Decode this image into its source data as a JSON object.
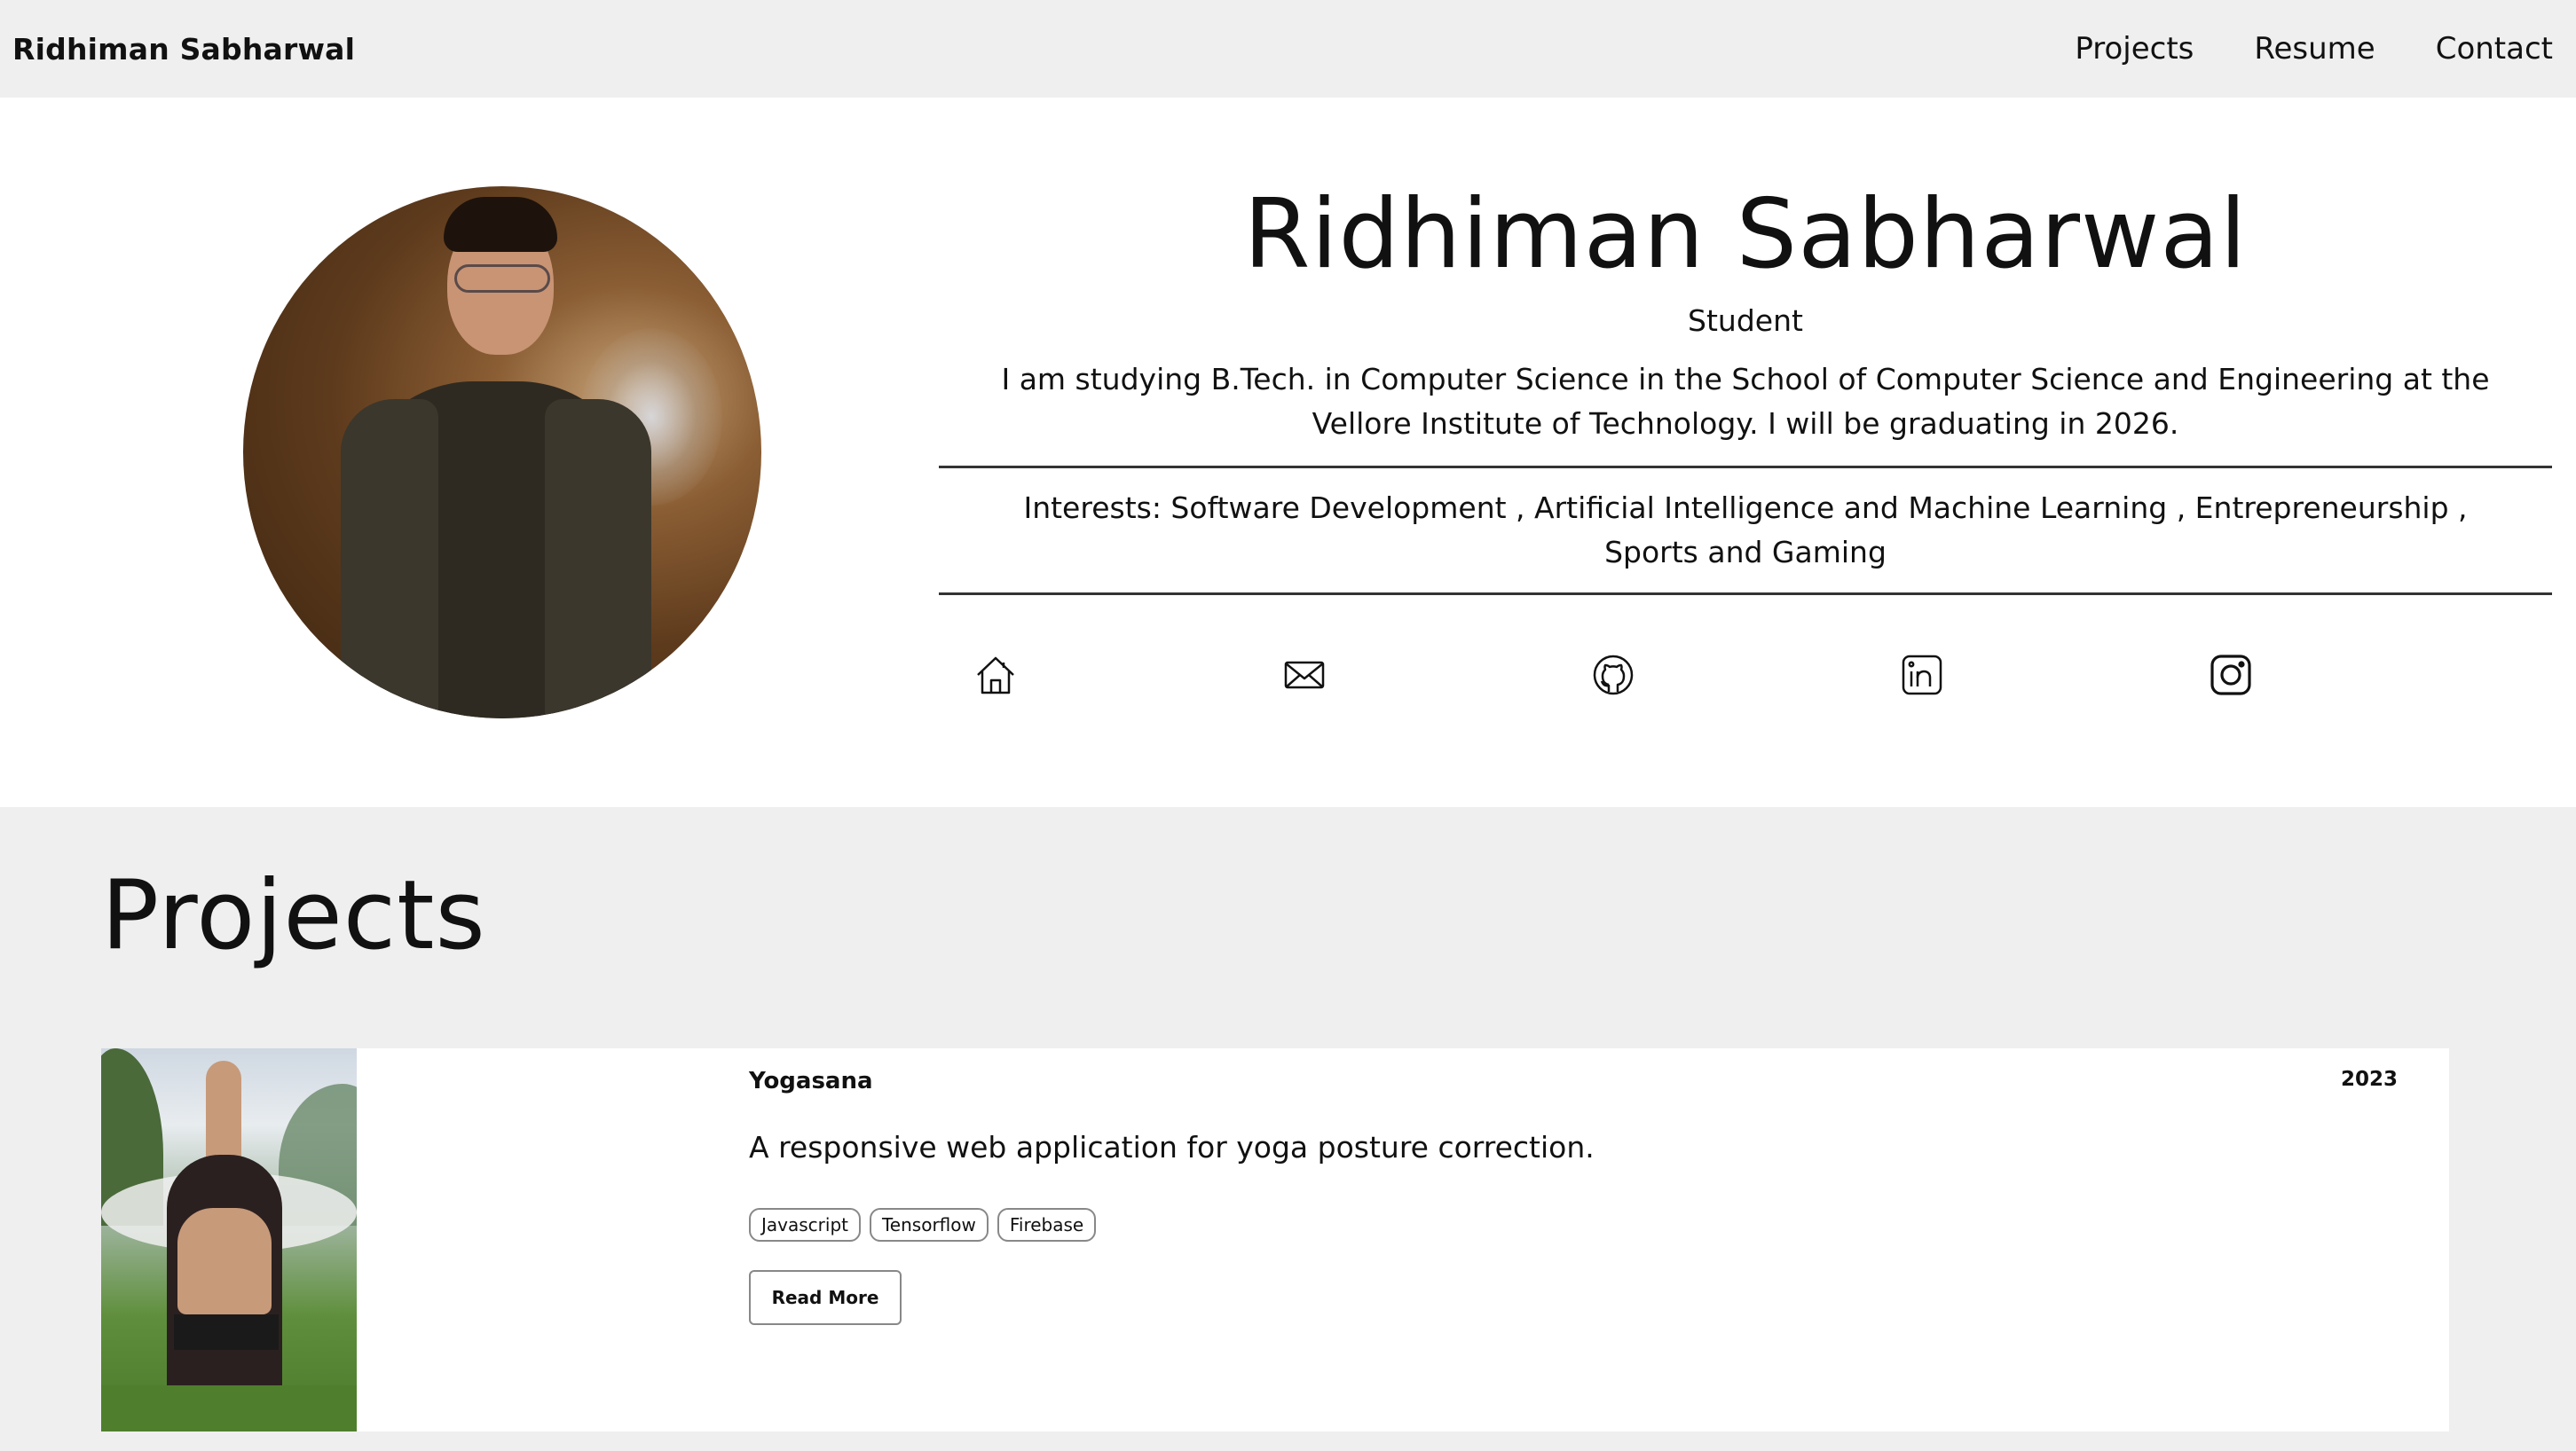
{
  "navbar": {
    "brand": "Ridhiman Sabharwal",
    "links": [
      "Projects",
      "Resume",
      "Contact"
    ]
  },
  "hero": {
    "name": "Ridhiman Sabharwal",
    "role": "Student",
    "bio": "I am studying B.Tech. in Computer Science in the School of Computer Science and Engineering at the Vellore Institute of Technology. I will be graduating in 2026.",
    "interests": "Interests: Software Development , Artificial Intelligence and Machine Learning , Entrepreneurship , Sports and Gaming",
    "socials": [
      "home-icon",
      "mail-icon",
      "github-icon",
      "linkedin-icon",
      "instagram-icon"
    ]
  },
  "projects": {
    "heading": "Projects",
    "items": [
      {
        "title": "Yogasana",
        "year": "2023",
        "description": "A responsive web application for yoga posture correction.",
        "tags": [
          "Javascript",
          "Tensorflow",
          "Firebase"
        ],
        "cta": "Read More"
      }
    ]
  }
}
